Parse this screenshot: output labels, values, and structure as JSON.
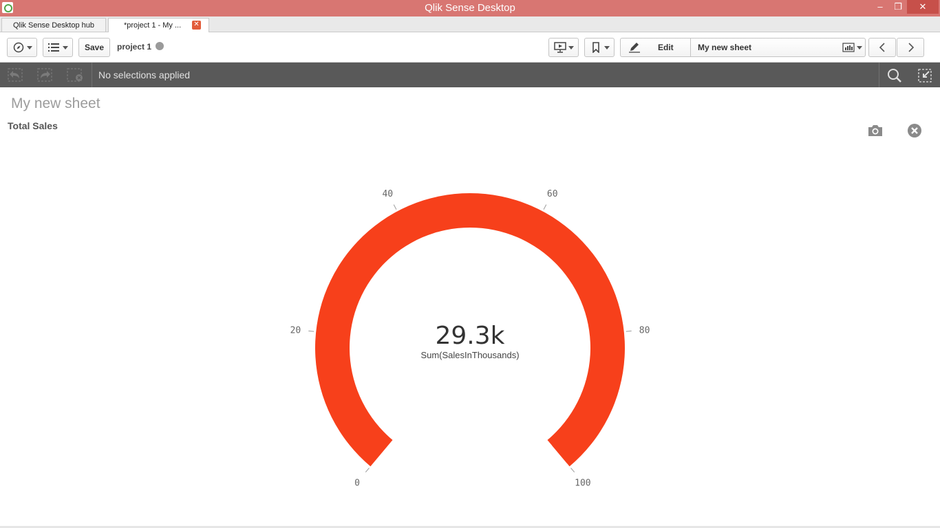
{
  "window": {
    "title": "Qlik Sense Desktop",
    "min_glyph": "–",
    "max_glyph": "❐",
    "close_glyph": "✕"
  },
  "tabs": [
    {
      "label": "Qlik Sense Desktop hub"
    },
    {
      "label": "*project 1 - My ...",
      "close_glyph": "✕"
    }
  ],
  "toolbar": {
    "save_label": "Save",
    "project_name": "project 1",
    "edit_label": "Edit",
    "sheet_label": "My new sheet"
  },
  "selections": {
    "text": "No selections applied"
  },
  "sheet": {
    "title": "My new sheet"
  },
  "chart": {
    "title": "Total Sales",
    "value_text": "29.3k",
    "measure_label": "Sum(SalesInThousands)"
  },
  "chart_data": {
    "type": "gauge",
    "title": "Total Sales",
    "measure": "Sum(SalesInThousands)",
    "value": 29.3,
    "value_label": "29.3k",
    "min": 0,
    "max": 100,
    "ticks": [
      0,
      20,
      40,
      60,
      80,
      100
    ],
    "bar_color": "#f7401b",
    "tick_color": "#9a9a9a"
  },
  "colors": {
    "titlebar": "#d87672",
    "selbar": "#595959",
    "accent": "#f7401b"
  }
}
